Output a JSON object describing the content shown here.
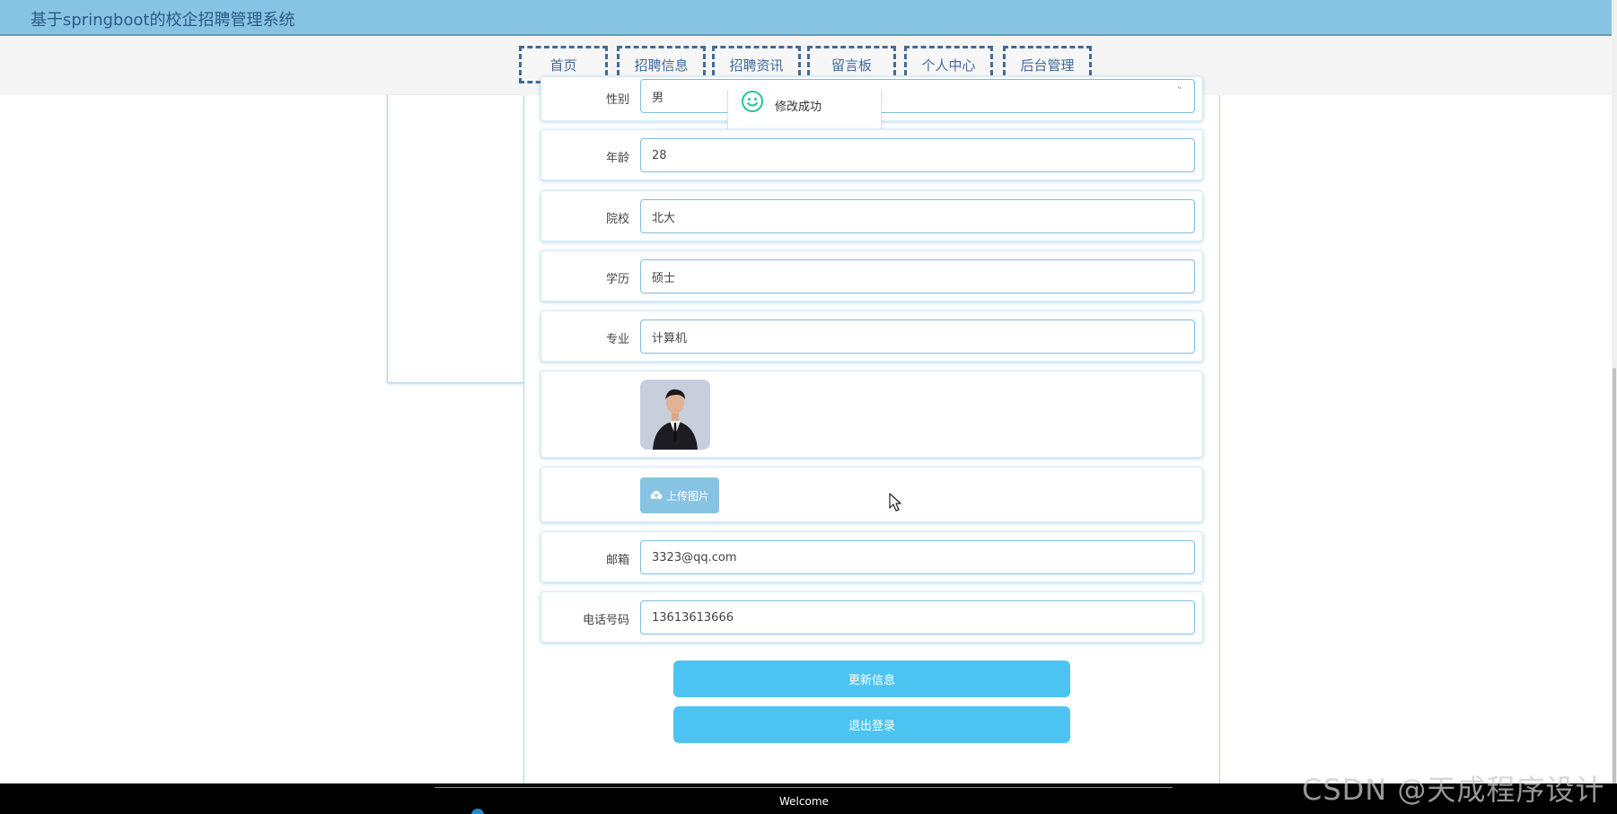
{
  "app": {
    "title": "基于springboot的校企招聘管理系统"
  },
  "nav": {
    "items": [
      {
        "label": "首页"
      },
      {
        "label": "招聘信息"
      },
      {
        "label": "招聘资讯"
      },
      {
        "label": "留言板"
      },
      {
        "label": "个人中心"
      },
      {
        "label": "后台管理"
      }
    ]
  },
  "toast": {
    "message": "修改成功",
    "icon": "smile-check-icon",
    "color": "#22c58a"
  },
  "form": {
    "gender": {
      "label": "性别",
      "value": "男"
    },
    "age": {
      "label": "年龄",
      "value": "28"
    },
    "school": {
      "label": "院校",
      "value": "北大"
    },
    "degree": {
      "label": "学历",
      "value": "硕士"
    },
    "major": {
      "label": "专业",
      "value": "计算机"
    },
    "photo": {
      "icon": "avatar-photo"
    },
    "upload_label": "上传图片",
    "email": {
      "label": "邮箱",
      "value": "3323@qq.com"
    },
    "phone": {
      "label": "电话号码",
      "value": "13613613666"
    }
  },
  "actions": {
    "update_label": "更新信息",
    "logout_label": "退出登录"
  },
  "footer": {
    "text": "Welcome"
  },
  "watermark": "CSDN @天成程序设计",
  "colors": {
    "header": "#87c3e3",
    "button": "#4cc4f2",
    "nav_border": "#3f6a9d"
  }
}
